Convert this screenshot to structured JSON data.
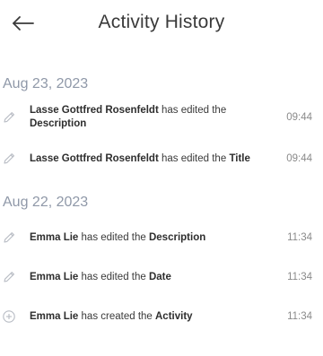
{
  "header": {
    "title": "Activity History",
    "back_icon": "arrow-left-icon"
  },
  "groups": [
    {
      "date": "Aug 23, 2023",
      "entries": [
        {
          "icon": "pencil-icon",
          "user": "Lasse Gottfred Rosenfeldt",
          "action": " has edited the ",
          "field": "Description",
          "time": "09:44"
        },
        {
          "icon": "pencil-icon",
          "user": "Lasse Gottfred Rosenfeldt",
          "action": " has edited the ",
          "field": "Title",
          "time": "09:44"
        }
      ]
    },
    {
      "date": "Aug 22, 2023",
      "entries": [
        {
          "icon": "pencil-icon",
          "user": "Emma Lie",
          "action": " has edited the ",
          "field": "Description",
          "time": "11:34"
        },
        {
          "icon": "pencil-icon",
          "user": "Emma Lie",
          "action": " has edited the ",
          "field": "Date",
          "time": "11:34"
        },
        {
          "icon": "plus-circle-icon",
          "user": "Emma Lie",
          "action": " has created the ",
          "field": "Activity",
          "time": "11:34"
        }
      ]
    }
  ],
  "colors": {
    "date": "#8f98a8",
    "icon": "#b8bcc4",
    "text": "#3a3a3a",
    "time": "#8a8a8a"
  }
}
